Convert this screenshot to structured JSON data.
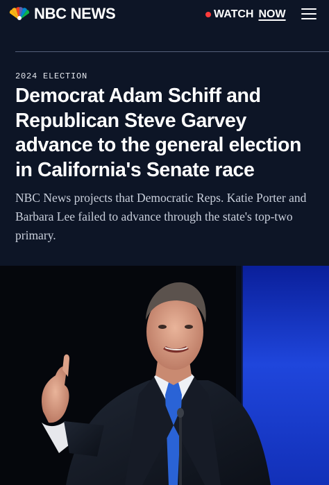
{
  "header": {
    "brand_name": "NBC NEWS",
    "logo_icon": "nbc-peacock-icon",
    "watch_label": "WATCH",
    "watch_now_label": "NOW",
    "live_indicator_color": "#ff3b3b",
    "menu_icon": "hamburger-menu-icon"
  },
  "article": {
    "eyebrow": "2024 ELECTION",
    "headline": "Democrat Adam Schiff and Republican Steve Garvey advance to the general election in California's Senate race",
    "dek": "NBC News projects that Democratic Reps. Katie Porter and Barbara Lee failed to advance through the state's top-two primary."
  },
  "hero_image": {
    "icon": "hero-photo"
  },
  "colors": {
    "background": "#0d1526",
    "headline": "#ffffff",
    "dek": "#c9cfdb",
    "stage_blue": "#1c3fd0"
  }
}
